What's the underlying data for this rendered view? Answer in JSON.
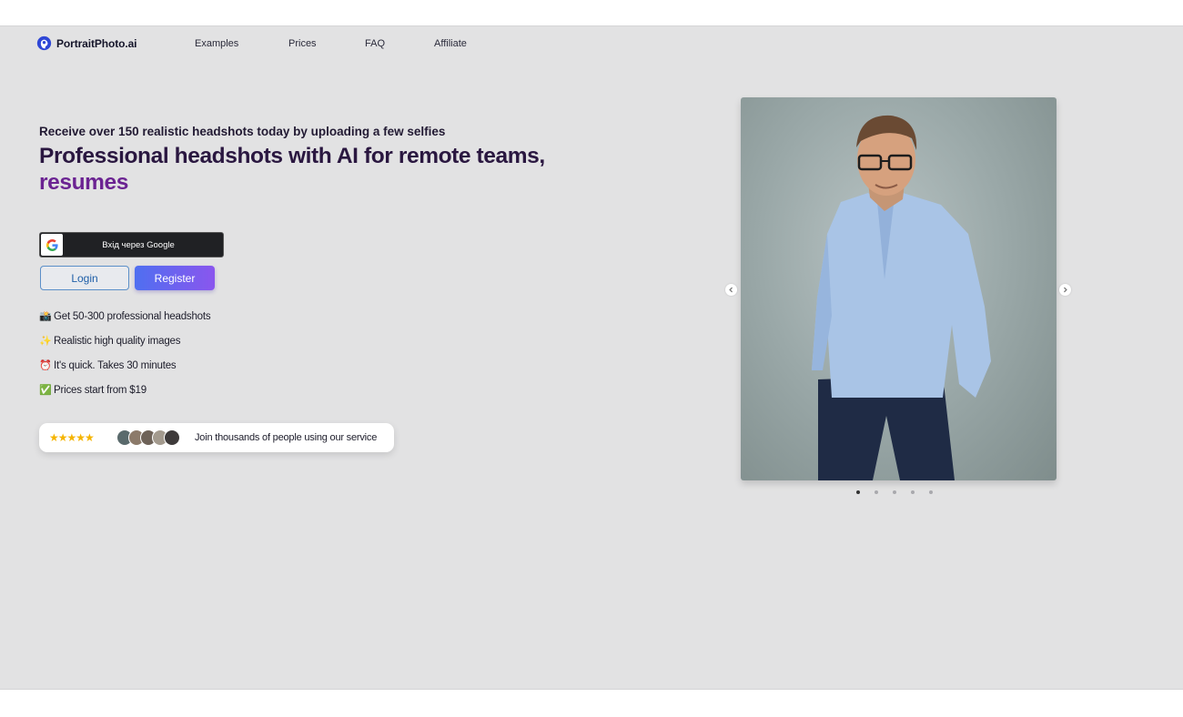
{
  "header": {
    "brand": "PortraitPhoto.ai",
    "nav": [
      {
        "label": "Examples"
      },
      {
        "label": "Prices"
      },
      {
        "label": "FAQ"
      },
      {
        "label": "Affiliate"
      }
    ]
  },
  "hero": {
    "subheadline": "Receive over 150 realistic headshots today by uploading a few selfies",
    "headline_line1": "Professional headshots with AI for remote teams,",
    "headline_line2": "resumes",
    "google_button": "Вхід через Google",
    "login_button": "Login",
    "register_button": "Register",
    "features": [
      {
        "emoji": "📸",
        "text": "Get 50-300 professional headshots"
      },
      {
        "emoji": "✨",
        "text": "Realistic high quality images"
      },
      {
        "emoji": "⏰",
        "text": "It's quick. Takes 30 minutes"
      },
      {
        "emoji": "✅",
        "text": "Prices start from $19"
      }
    ],
    "social_proof": {
      "rating": 4.5,
      "stars": "★★★★★",
      "avatar_count": 5,
      "text": "Join thousands of people using our service"
    }
  },
  "carousel": {
    "slide_count": 5,
    "active_index": 0,
    "prev_icon": "chevron-left-icon",
    "next_icon": "chevron-right-icon"
  },
  "colors": {
    "background": "#e2e2e3",
    "headline": "#2a1740",
    "accent": "#6b2392",
    "register_gradient_start": "#4f6ff0",
    "register_gradient_end": "#8a56ee",
    "star": "#f5b400"
  }
}
